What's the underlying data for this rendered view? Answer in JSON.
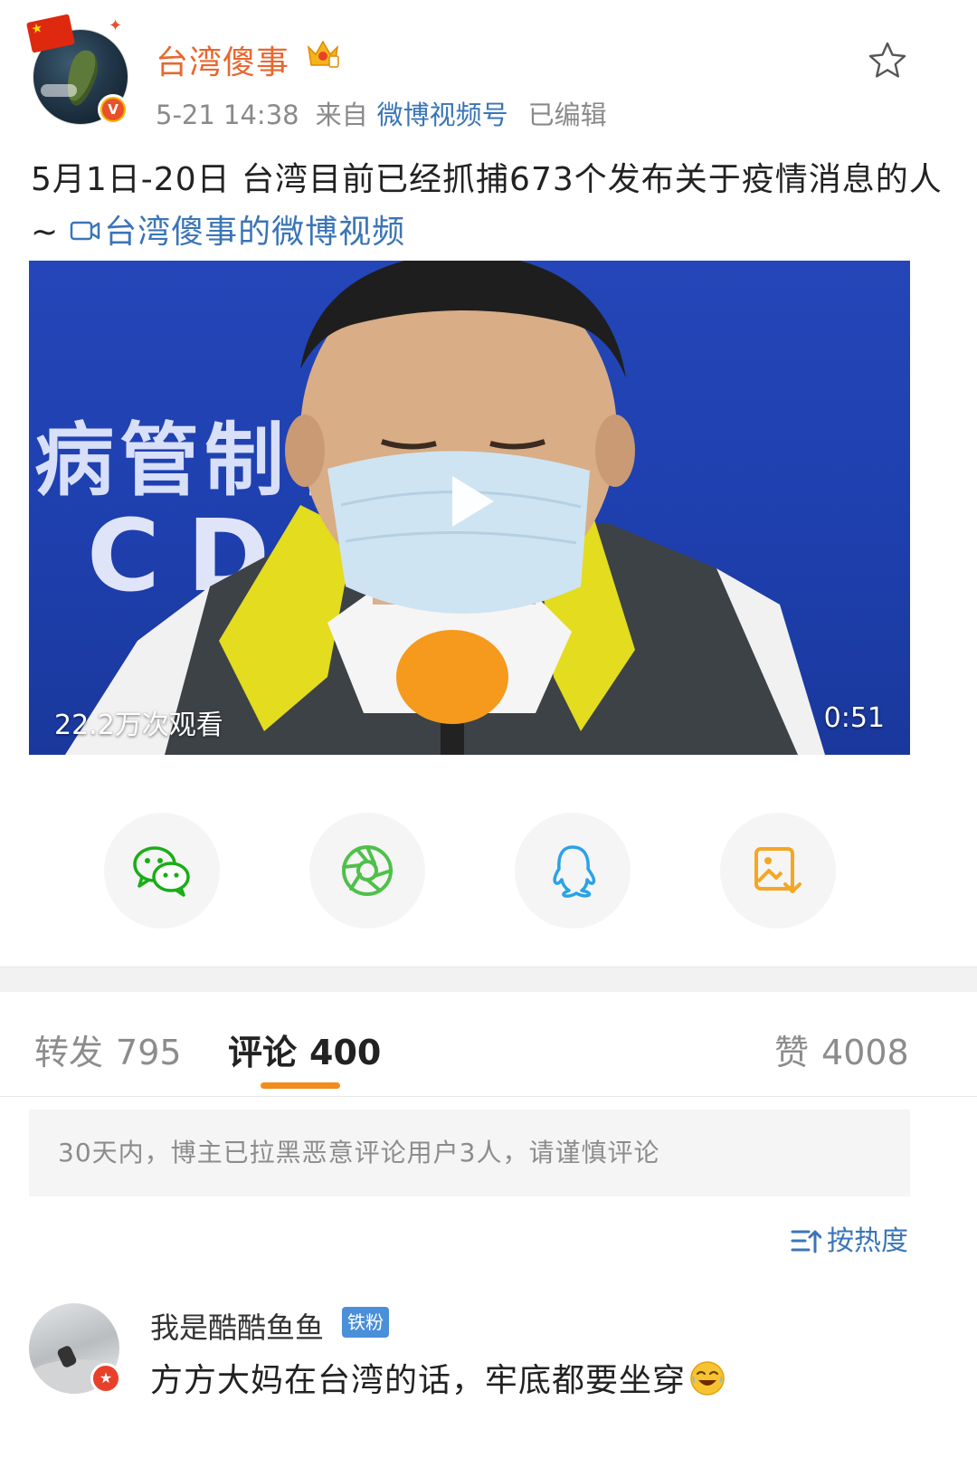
{
  "post": {
    "author": "台湾傻事",
    "time": "5-21 14:38",
    "from_label": "来自",
    "source": "微博视频号",
    "edited": "已编辑",
    "text": "5月1日-20日 台湾目前已经抓捕673个发布关于疫情消息的人 ~",
    "video_link": "台湾傻事的微博视频"
  },
  "video": {
    "views": "22.2万次观看",
    "duration": "0:51",
    "backdrop_text": "病管制署",
    "backdrop_cdc": "CDC"
  },
  "share": {
    "icons": [
      "wechat-icon",
      "moments-icon",
      "qq-icon",
      "save-image-icon"
    ],
    "colors": {
      "wechat": "#1aad19",
      "moments": "#4fc04a",
      "qq": "#2aa2e8",
      "save": "#f5a623"
    }
  },
  "tabs": {
    "repost_label": "转发",
    "repost_count": "795",
    "comment_label": "评论",
    "comment_count": "400",
    "like_label": "赞",
    "like_count": "4008"
  },
  "notice": "30天内，博主已拉黑恶意评论用户3人，请谨慎评论",
  "sort_label": "按热度",
  "comments": [
    {
      "name": "我是酷酷鱼鱼",
      "tag": "铁粉",
      "text": "方方大妈在台湾的话，牢底都要坐穿"
    }
  ],
  "colors": {
    "accent_orange": "#e8672e",
    "link_blue": "#3a75b7",
    "tab_indicator": "#f28c1d"
  }
}
